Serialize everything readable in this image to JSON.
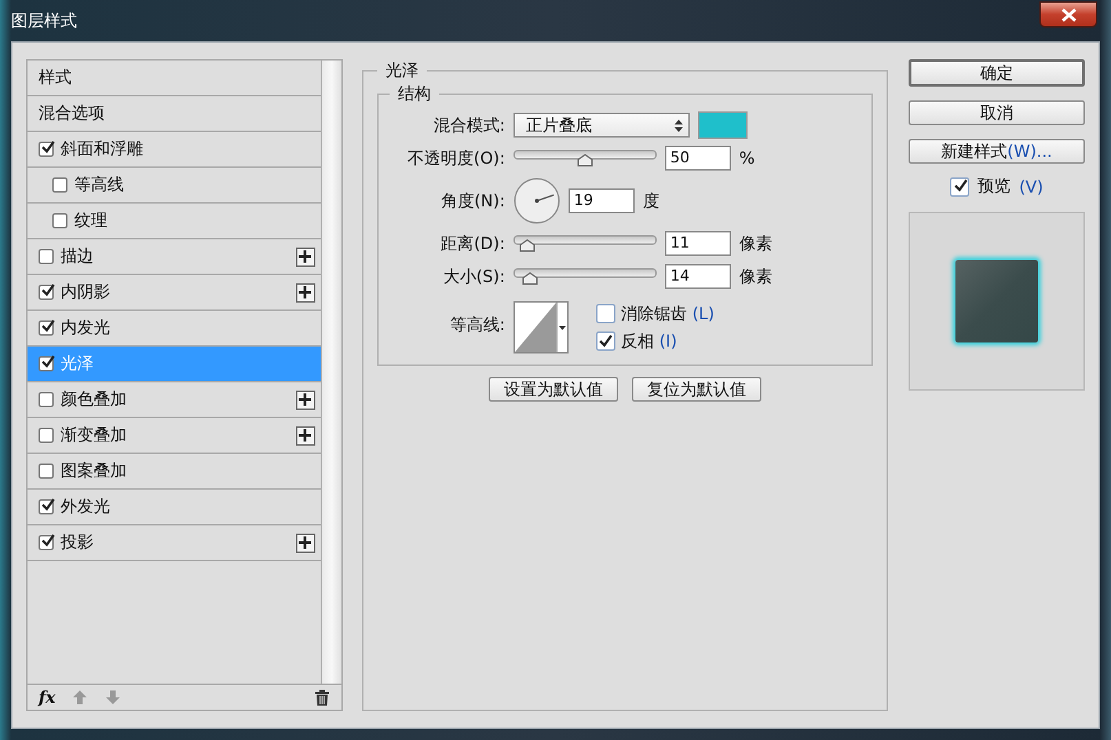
{
  "window": {
    "title": "图层样式"
  },
  "style_list": {
    "items": [
      {
        "label": "样式",
        "kind": "header",
        "selected": false
      },
      {
        "label": "混合选项",
        "kind": "plain",
        "selected": false
      },
      {
        "label": "斜面和浮雕",
        "kind": "check",
        "checked": true,
        "selected": false,
        "children": [
          {
            "label": "等高线",
            "kind": "check",
            "checked": false,
            "selected": false
          },
          {
            "label": "纹理",
            "kind": "check",
            "checked": false,
            "selected": false
          }
        ]
      },
      {
        "label": "描边",
        "kind": "check",
        "checked": false,
        "selected": false,
        "addable": true
      },
      {
        "label": "内阴影",
        "kind": "check",
        "checked": true,
        "selected": false,
        "addable": true
      },
      {
        "label": "内发光",
        "kind": "check",
        "checked": true,
        "selected": false
      },
      {
        "label": "光泽",
        "kind": "check",
        "checked": true,
        "selected": true
      },
      {
        "label": "颜色叠加",
        "kind": "check",
        "checked": false,
        "selected": false,
        "addable": true
      },
      {
        "label": "渐变叠加",
        "kind": "check",
        "checked": false,
        "selected": false,
        "addable": true
      },
      {
        "label": "图案叠加",
        "kind": "check",
        "checked": false,
        "selected": false
      },
      {
        "label": "外发光",
        "kind": "check",
        "checked": true,
        "selected": false
      },
      {
        "label": "投影",
        "kind": "check",
        "checked": true,
        "selected": false,
        "addable": true
      }
    ],
    "footer": {
      "fx": "fx"
    }
  },
  "panel": {
    "title": "光泽",
    "group": "结构",
    "blend_mode": {
      "label": "混合模式:",
      "value": "正片叠底",
      "color": "#1fbfcb"
    },
    "opacity": {
      "label": "不透明度(O):",
      "level": 0.5,
      "value": "50",
      "unit": "%"
    },
    "angle": {
      "label": "角度(N):",
      "value": "19",
      "unit": "度"
    },
    "distance": {
      "label": "距离(D):",
      "level": 0.05,
      "value": "11",
      "unit": "像素"
    },
    "size": {
      "label": "大小(S):",
      "level": 0.07,
      "value": "14",
      "unit": "像素"
    },
    "contour": {
      "label": "等高线:"
    },
    "anti_alias": {
      "label": "消除锯齿",
      "hotkey": "(L)",
      "checked": false
    },
    "invert": {
      "label": "反相",
      "hotkey": "(I)",
      "checked": true
    },
    "buttons": [
      "设置为默认值",
      "复位为默认值"
    ]
  },
  "side": {
    "ok": "确定",
    "cancel": "取消",
    "new_style": {
      "label": "新建样式",
      "hotkey": "(W)..."
    },
    "preview": {
      "label": "预览",
      "hotkey": "(V)",
      "checked": true
    }
  }
}
